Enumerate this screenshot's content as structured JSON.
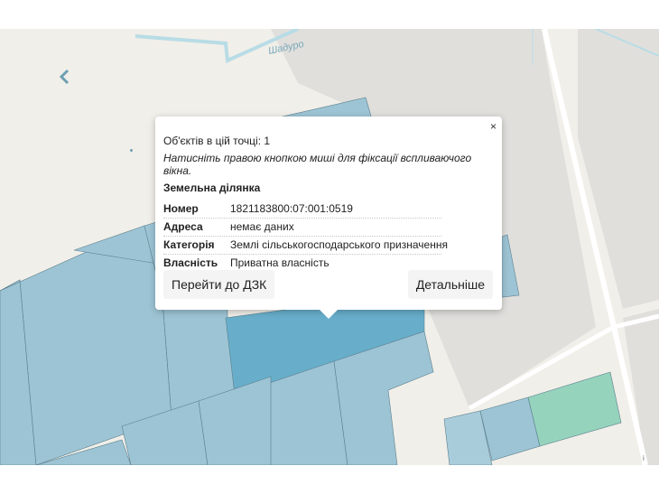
{
  "map": {
    "street_label": "Шадуро",
    "colors": {
      "background": "#f1efe9",
      "block": "#e0dfdc",
      "road": "#ffffff",
      "parcel": "#9dc4d4",
      "parcel_selected": "#68aecb",
      "parcel_green": "#95d3bd",
      "water_line": "#b8dce6"
    }
  },
  "popup": {
    "close_label": "×",
    "objects_text": "Об'єктів в цій точці: 1",
    "hint_text": "Натисніть правою кнопкою миші для фіксації вспливаючого вікна.",
    "section_title": "Земельна ділянка",
    "rows": [
      {
        "key": "Номер",
        "value": "1821183800:07:001:0519"
      },
      {
        "key": "Адреса",
        "value": "немає даних"
      },
      {
        "key": "Категорія",
        "value": "Землі сільськогосподарського призначення"
      },
      {
        "key": "Власність",
        "value": "Приватна власність"
      }
    ],
    "btn_dzk": "Перейти до ДЗК",
    "btn_details": "Детальніше"
  },
  "icons": {
    "back": "chevron-left-icon"
  },
  "attribution": "i"
}
